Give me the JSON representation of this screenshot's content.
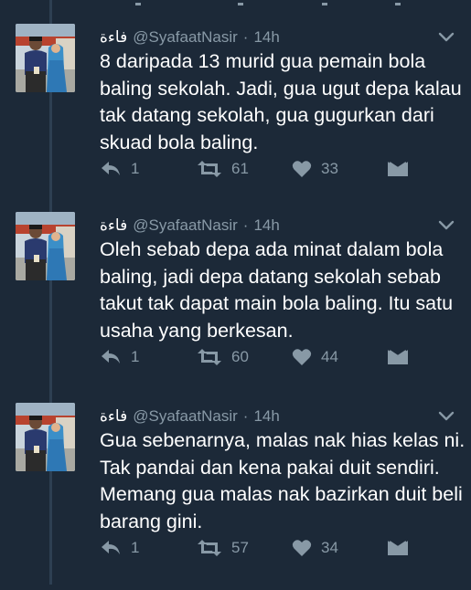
{
  "tweets": [
    {
      "display_name": "فاءة",
      "handle": "@SyafaatNasir",
      "separator": "·",
      "time": "14h",
      "lines": [
        "8 daripada 13 murid gua pemain bola",
        "baling sekolah. Jadi, gua ugut depa kalau",
        "tak datang sekolah, gua gugurkan dari",
        "skuad bola baling."
      ],
      "replies": "1",
      "retweets": "61",
      "likes": "33"
    },
    {
      "display_name": "فاءة",
      "handle": "@SyafaatNasir",
      "separator": "·",
      "time": "14h",
      "lines": [
        "Oleh sebab depa ada minat dalam bola",
        "baling, jadi depa datang sekolah sebab",
        "takut tak dapat main bola baling. Itu satu",
        "usaha yang berkesan."
      ],
      "replies": "1",
      "retweets": "60",
      "likes": "44"
    },
    {
      "display_name": "فاءة",
      "handle": "@SyafaatNasir",
      "separator": "·",
      "time": "14h",
      "lines": [
        "Gua sebenarnya, malas nak hias kelas ni.",
        "Tak pandai dan kena pakai duit sendiri.",
        "Memang gua malas nak bazirkan duit beli",
        "barang gini."
      ],
      "replies": "1",
      "retweets": "57",
      "likes": "34"
    }
  ],
  "colors": {
    "background": "#1c2938",
    "text": "#ffffff",
    "muted": "#8899a6",
    "thread_line": "#2d3f52"
  },
  "icons": {
    "reply": "reply-icon",
    "retweet": "retweet-icon",
    "like": "heart-icon",
    "dm": "envelope-icon",
    "menu": "chevron-down-icon"
  }
}
